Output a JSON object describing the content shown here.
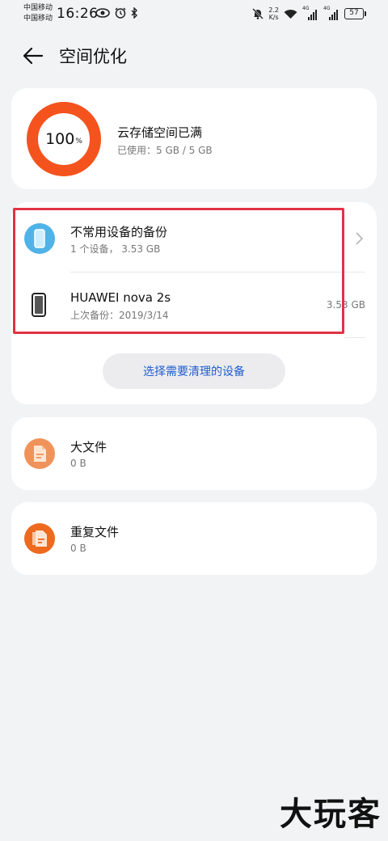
{
  "status_bar": {
    "carrier_line1": "中国移动",
    "carrier_line2": "中国移动",
    "time": "16:26",
    "net_speed_value": "2.2",
    "net_speed_unit": "K/s",
    "signal1_label": "4G",
    "signal2_label": "4G",
    "battery": "57"
  },
  "header": {
    "title": "空间优化"
  },
  "storage": {
    "percent": "100",
    "percent_unit": "%",
    "percent_value": 1.0,
    "title": "云存储空间已满",
    "usage": "已使用：5 GB / 5 GB",
    "ring_color": "#f5531e"
  },
  "devices": {
    "group_title": "不常用设备的备份",
    "group_sub": "1 个设备， 3.53 GB",
    "device_name": "HUAWEI nova 2s",
    "device_sub": "上次备份：2019/3/14",
    "device_size": "3.53 GB",
    "select_button": "选择需要清理的设备"
  },
  "big_files": {
    "title": "大文件",
    "size": "0 B"
  },
  "dup_files": {
    "title": "重复文件",
    "size": "0 B"
  },
  "watermark": "大玩客",
  "colors": {
    "accent_blue": "#1f5ecf",
    "highlight_red": "#e03344",
    "file_orange": "#f0935a",
    "dup_orange": "#ee6a1e"
  }
}
